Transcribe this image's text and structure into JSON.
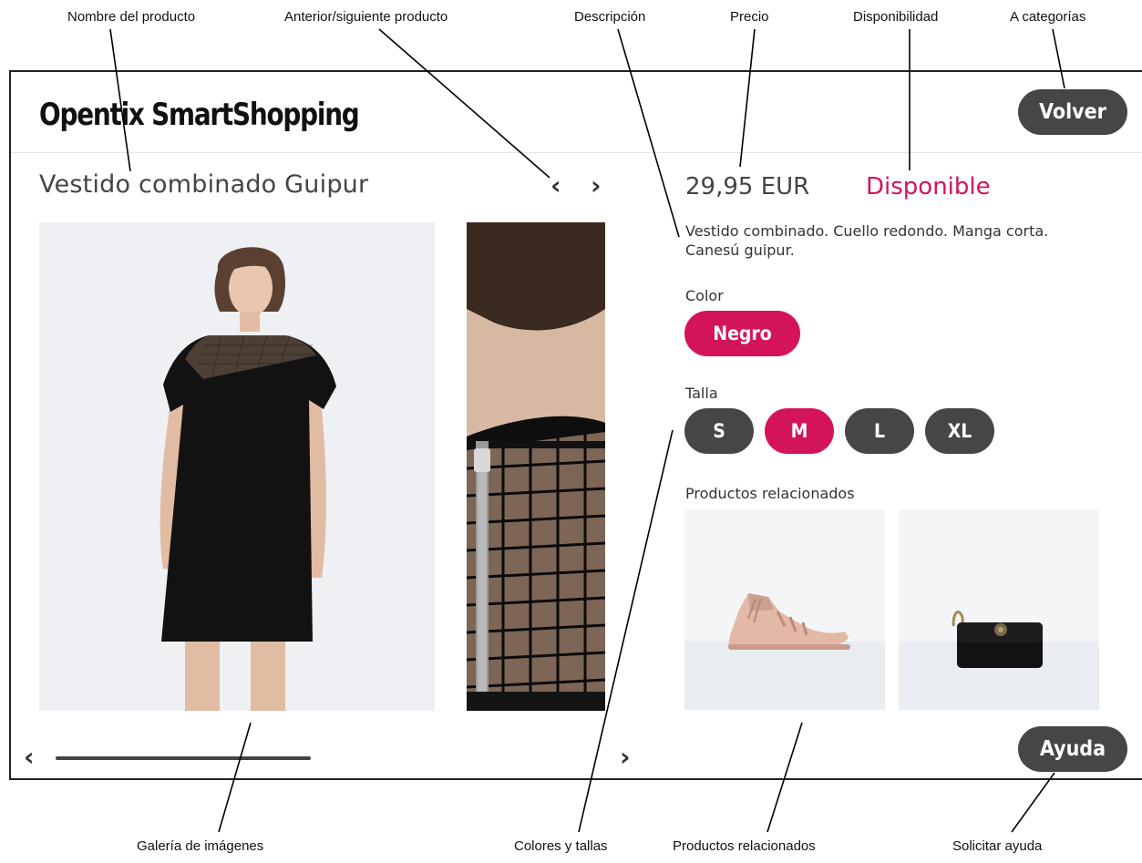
{
  "app": {
    "title": "Opentix SmartShopping",
    "back_label": "Volver",
    "help_label": "Ayuda"
  },
  "product": {
    "name": "Vestido combinado Guipur",
    "price": "29,95 EUR",
    "availability": "Disponible",
    "description": "Vestido combinado. Cuello redondo. Manga corta. Canesú guipur.",
    "color_label": "Color",
    "colors": [
      "Negro"
    ],
    "selected_color": "Negro",
    "size_label": "Talla",
    "sizes": [
      "S",
      "M",
      "L",
      "XL"
    ],
    "selected_size": "M",
    "related_label": "Productos relacionados",
    "related_items": [
      "sandal",
      "handbag"
    ]
  },
  "nav": {
    "prev_product": "‹",
    "next_product": "›",
    "gallery_prev": "‹",
    "gallery_next": "›"
  },
  "annotations": {
    "product_name": "Nombre del producto",
    "prev_next": "Anterior/siguiente producto",
    "description": "Descripción",
    "price": "Precio",
    "availability": "Disponibilidad",
    "to_categories": "A categorías",
    "gallery": "Galería de imágenes",
    "colors_sizes": "Colores y tallas",
    "related": "Productos relacionados",
    "help": "Solicitar ayuda"
  },
  "colors": {
    "accent": "#d4145a",
    "dark_button": "#464646"
  }
}
